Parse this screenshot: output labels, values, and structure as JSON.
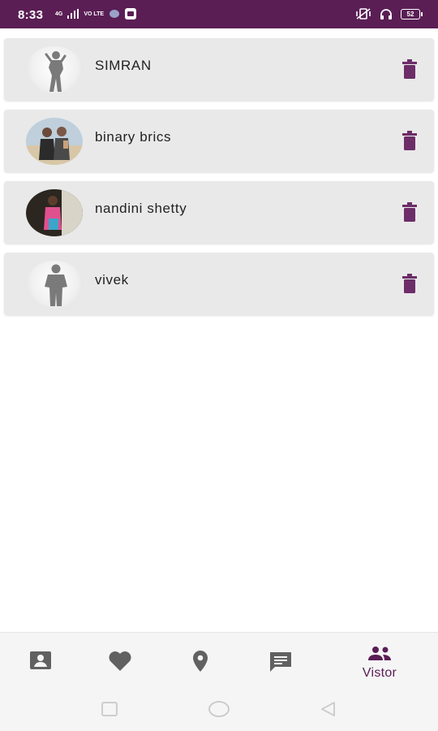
{
  "status_bar": {
    "time": "8:33",
    "network_badge_1": "4G",
    "network_badge_2": "VO LTE",
    "battery": "52"
  },
  "visitors": [
    {
      "name": "SIMRAN",
      "avatar": "female-silhouette"
    },
    {
      "name": "binary brics",
      "avatar": "photo-couple-beach"
    },
    {
      "name": "nandini shetty",
      "avatar": "photo-woman-pink"
    },
    {
      "name": "vivek",
      "avatar": "male-silhouette"
    }
  ],
  "bottom_nav": {
    "items": [
      {
        "icon": "profile-card-icon",
        "label": ""
      },
      {
        "icon": "heart-icon",
        "label": ""
      },
      {
        "icon": "location-pin-icon",
        "label": ""
      },
      {
        "icon": "chat-icon",
        "label": ""
      },
      {
        "icon": "people-icon",
        "label": "Vistor",
        "active": true
      }
    ]
  },
  "colors": {
    "primary": "#5a1e55",
    "card": "#e9e9e9",
    "icon_inactive": "#616161",
    "delete_icon": "#6d2d69"
  }
}
